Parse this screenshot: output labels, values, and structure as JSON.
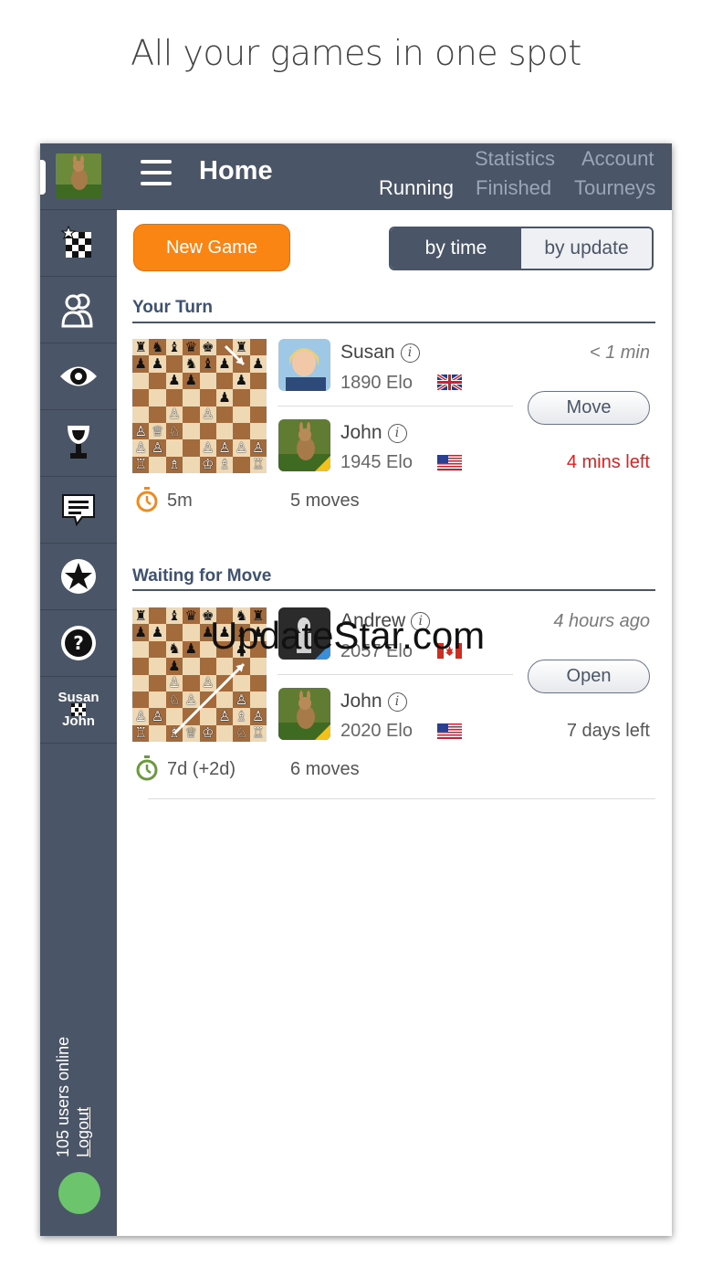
{
  "caption": "All your games in one spot",
  "sidebar": {
    "match_label_top": "Susan",
    "match_label_bottom": "John",
    "online_text": "105 users online",
    "logout_label": "Logout"
  },
  "header": {
    "title": "Home",
    "nav": {
      "statistics": "Statistics",
      "account": "Account",
      "running": "Running",
      "finished": "Finished",
      "tourneys": "Tourneys"
    }
  },
  "toolbar": {
    "new_game": "New Game",
    "sort_by_time": "by time",
    "sort_by_update": "by update"
  },
  "sections": {
    "your_turn": "Your Turn",
    "waiting": "Waiting for Move"
  },
  "game1": {
    "player1": {
      "name": "Susan",
      "elo": "1890 Elo",
      "flag": "uk-flag"
    },
    "player2": {
      "name": "John",
      "elo": "1945 Elo",
      "flag": "us-flag"
    },
    "ago": "< 1 min",
    "action": "Move",
    "time_left": "4 mins left",
    "time_left_color": "#e02020",
    "time_control": "5m",
    "moves": "5 moves"
  },
  "game2": {
    "player1": {
      "name": "Andrew",
      "elo": "2057 Elo",
      "flag": "canada-flag"
    },
    "player2": {
      "name": "John",
      "elo": "2020 Elo",
      "flag": "us-flag"
    },
    "ago": "4 hours ago",
    "action": "Open",
    "time_left": "7 days left",
    "time_left_color": "#555555",
    "time_control": "7d (+2d)",
    "moves": "6 moves"
  },
  "watermark": "UpdateStar.com",
  "colors": {
    "nav_bg": "#4a5668",
    "accent_orange": "#fb8512",
    "online_green": "#6cc46c",
    "timer_orange": "#f08a1c",
    "timer_green": "#6a9a3c"
  }
}
